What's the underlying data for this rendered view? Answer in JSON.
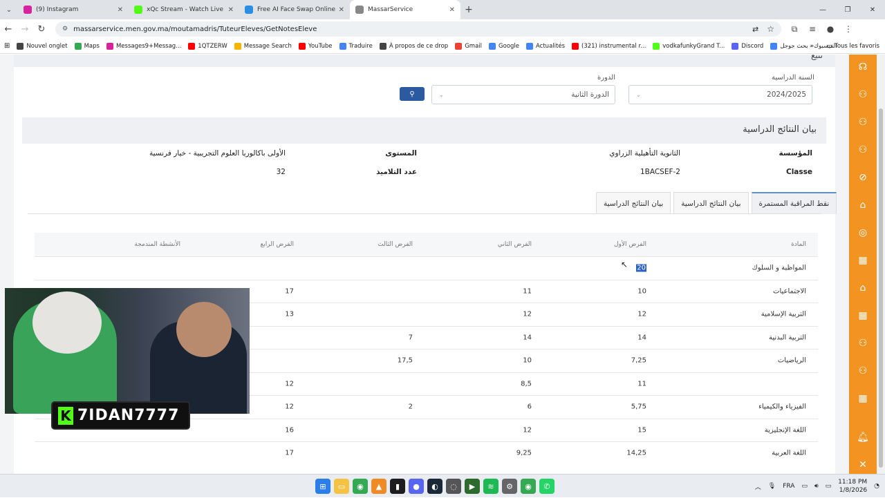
{
  "browser": {
    "tabs": [
      {
        "title": "(9) Instagram",
        "color": "#d6249f"
      },
      {
        "title": "xQc Stream - Watch Live on Kic",
        "color": "#53fc18"
      },
      {
        "title": "Free AI Face Swap Online (No S",
        "color": "#2b8de3"
      },
      {
        "title": "MassarService",
        "color": "#888888"
      }
    ],
    "url": "massarservice.men.gov.ma/moutamadris/TuteurEleves/GetNotesEleve",
    "bookmarks": [
      {
        "label": "Nouvel onglet",
        "color": "#444"
      },
      {
        "label": "Maps",
        "color": "#34a853"
      },
      {
        "label": "Messages9+Messag...",
        "color": "#d6249f"
      },
      {
        "label": "1QTZERW",
        "color": "#ff0000"
      },
      {
        "label": "Message Search",
        "color": "#f4b400"
      },
      {
        "label": "YouTube",
        "color": "#ff0000"
      },
      {
        "label": "Traduire",
        "color": "#4285f4"
      },
      {
        "label": "À propos de ce drop",
        "color": "#444"
      },
      {
        "label": "Gmail",
        "color": "#ea4335"
      },
      {
        "label": "Google",
        "color": "#4285f4"
      },
      {
        "label": "Actualités",
        "color": "#4285f4"
      },
      {
        "label": "(321) instrumental r...",
        "color": "#ff0000"
      },
      {
        "label": "vodkafunkyGrand T...",
        "color": "#53fc18"
      },
      {
        "label": "Discord",
        "color": "#5865f2"
      },
      {
        "label": "الفيسبوك - بحث جوجل",
        "color": "#4285f4"
      }
    ],
    "all_bookmarks": "Tous les favoris"
  },
  "filters": {
    "year_label": "السنة الدراسية",
    "year_value": "2024/2025",
    "session_label": "الدورة",
    "session_value": "الدورة الثانية"
  },
  "panel": {
    "title": "بيان النتائج الدراسية",
    "institution_label": "المؤسسة",
    "institution_value": "الثانوية التأهيلية الزراوي",
    "class_label": "Classe",
    "class_value": "1BACSEF-2",
    "level_label": "المستوى",
    "level_value": "الأولى باكالوريا العلوم التجريبية - خيار فرنسية",
    "students_label": "عدد التلاميذ",
    "students_value": "32"
  },
  "tabs": [
    {
      "label": "نقط المراقبة المستمرة",
      "active": true
    },
    {
      "label": "بيان النتائج الدراسية",
      "active": false
    },
    {
      "label": "بيان النتائج الدراسية",
      "active": false
    }
  ],
  "table": {
    "headers": {
      "subject": "المادة",
      "t1": "الفرض الأول",
      "t2": "الفرض الثاني",
      "t3": "الفرض الثالث",
      "t4": "الفرض الرابع",
      "act": "الأنشطة المندمجة"
    },
    "rows": [
      {
        "subject": "المواظبة و السلوك",
        "t1": "20",
        "t2": "",
        "t3": "",
        "t4": "",
        "act": ""
      },
      {
        "subject": "الاجتماعيات",
        "t1": "10",
        "t2": "11",
        "t3": "",
        "t4": "17",
        "act": ""
      },
      {
        "subject": "التربية الإسلامية",
        "t1": "12",
        "t2": "12",
        "t3": "",
        "t4": "13",
        "act": ""
      },
      {
        "subject": "التربية البدنية",
        "t1": "14",
        "t2": "14",
        "t3": "7",
        "t4": "",
        "act": ""
      },
      {
        "subject": "الرياضيات",
        "t1": "7,25",
        "t2": "10",
        "t3": "17,5",
        "t4": "",
        "act": ""
      },
      {
        "subject": "",
        "t1": "11",
        "t2": "8,5",
        "t3": "",
        "t4": "12",
        "act": ""
      },
      {
        "subject": "الفيزياء والكيمياء",
        "t1": "5,75",
        "t2": "6",
        "t3": "2",
        "t4": "12",
        "act": ""
      },
      {
        "subject": "اللغة الإنجليزية",
        "t1": "15",
        "t2": "12",
        "t3": "",
        "t4": "16",
        "act": ""
      },
      {
        "subject": "اللغة العربية",
        "t1": "14,25",
        "t2": "9,25",
        "t3": "",
        "t4": "17",
        "act": ""
      }
    ]
  },
  "stream": {
    "name": "7IDAN7777",
    "brand": "K"
  },
  "taskbar": {
    "lang": "FRA",
    "time": "11:18 PM",
    "date": "1/8/2026",
    "badge": "99+"
  }
}
